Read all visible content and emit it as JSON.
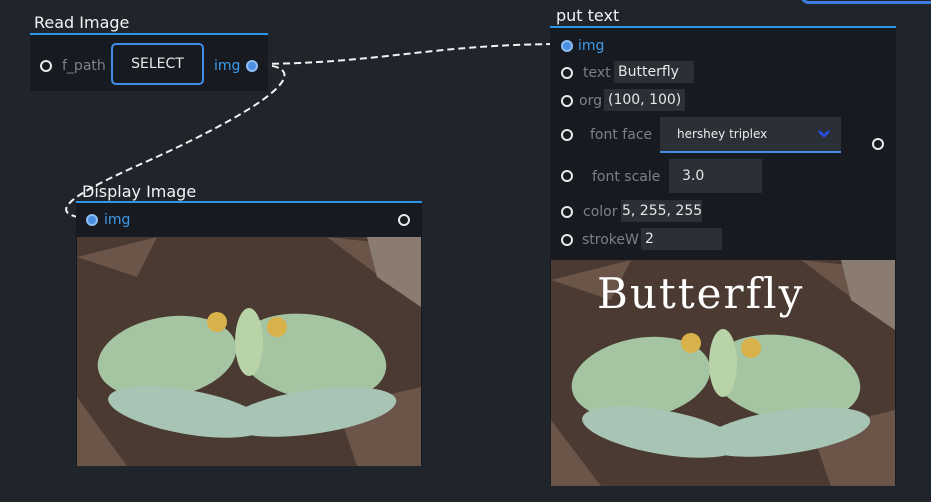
{
  "read_node": {
    "title": "Read Image",
    "path_label": "f_path",
    "select_label": "SELECT",
    "out_label": "img"
  },
  "display_node": {
    "title": "Display Image",
    "in_label": "img"
  },
  "puttext_node": {
    "title": "put text",
    "in_label": "img",
    "text_label": "text",
    "text_value": "Butterfly",
    "org_label": "org",
    "org_value": "(100, 100)",
    "fontface_label": "font face",
    "fontface_value": "hershey triplex",
    "fontscale_label": "font scale",
    "fontscale_value": "3.0",
    "color_label": "color",
    "color_value": "5, 255, 255)",
    "strokew_label": "strokeW",
    "strokew_value": "2",
    "overlay_text": "Butterfly"
  },
  "colors": {
    "accent": "#2f95e8",
    "background": "#20242b",
    "node_bg": "#171b21"
  }
}
